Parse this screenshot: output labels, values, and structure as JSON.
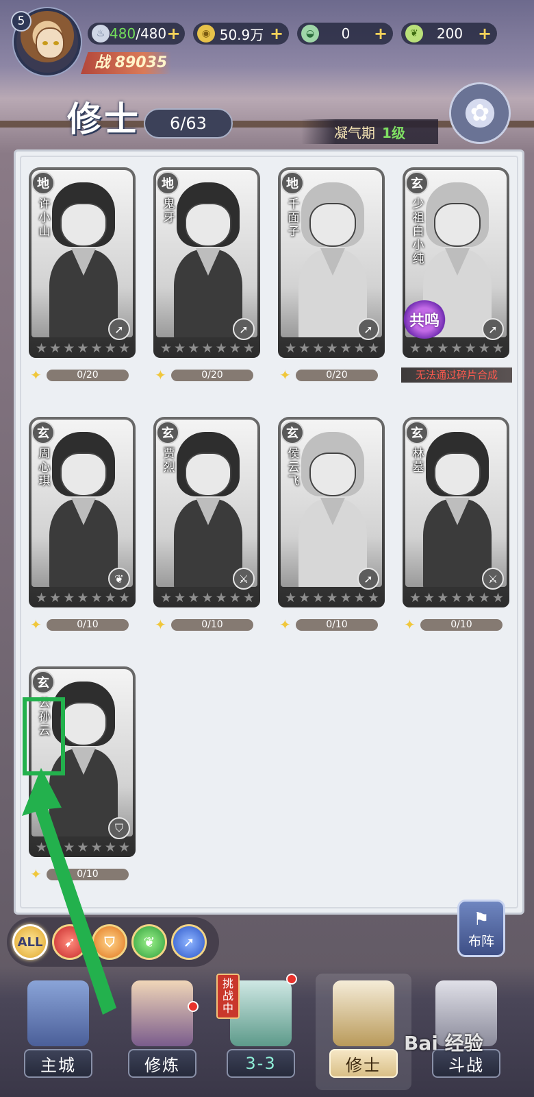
{
  "player": {
    "level": "5",
    "power_label": "战",
    "power_value": "89035"
  },
  "resources": [
    {
      "icon": "stamina-icon",
      "current": "480",
      "max": "480"
    },
    {
      "icon": "coin-icon",
      "value": "50.9万"
    },
    {
      "icon": "jade-icon",
      "value": "0"
    },
    {
      "icon": "leaf-icon",
      "value": "200"
    }
  ],
  "page": {
    "title": "修士",
    "count": "6/63",
    "realm_name": "凝气期",
    "realm_level": "1级"
  },
  "cards": [
    {
      "grade": "地",
      "name": "许小山",
      "type": "arrow",
      "progress": "0/20"
    },
    {
      "grade": "地",
      "name": "鬼牙",
      "type": "arrow",
      "progress": "0/20"
    },
    {
      "grade": "地",
      "name": "千面子",
      "type": "arrow",
      "progress": "0/20"
    },
    {
      "grade": "玄",
      "name": "少祖白小纯",
      "type": "arrow",
      "badge": "共鸣",
      "notice": "无法通过碎片合成"
    },
    {
      "grade": "玄",
      "name": "周心琪",
      "type": "leaf",
      "progress": "0/10"
    },
    {
      "grade": "玄",
      "name": "贾烈",
      "type": "sword",
      "progress": "0/10"
    },
    {
      "grade": "玄",
      "name": "侯云飞",
      "type": "arrow",
      "progress": "0/10"
    },
    {
      "grade": "玄",
      "name": "林墓",
      "type": "sword",
      "progress": "0/10"
    },
    {
      "grade": "玄",
      "name": "公孙云",
      "type": "shield",
      "progress": "0/10"
    }
  ],
  "filters": {
    "all_label": "ALL"
  },
  "formation_label": "布阵",
  "nav": {
    "main_city": "主城",
    "cultivate": "修炼",
    "stage": "3-3",
    "challenge_badge": "挑战中",
    "cultivators": "修士",
    "fight": "斗战"
  },
  "watermark": "Bai 经验",
  "colors": {
    "highlight": "#23b14d",
    "warn_text": "#ff5a4e",
    "stamina_green": "#73e05b"
  }
}
